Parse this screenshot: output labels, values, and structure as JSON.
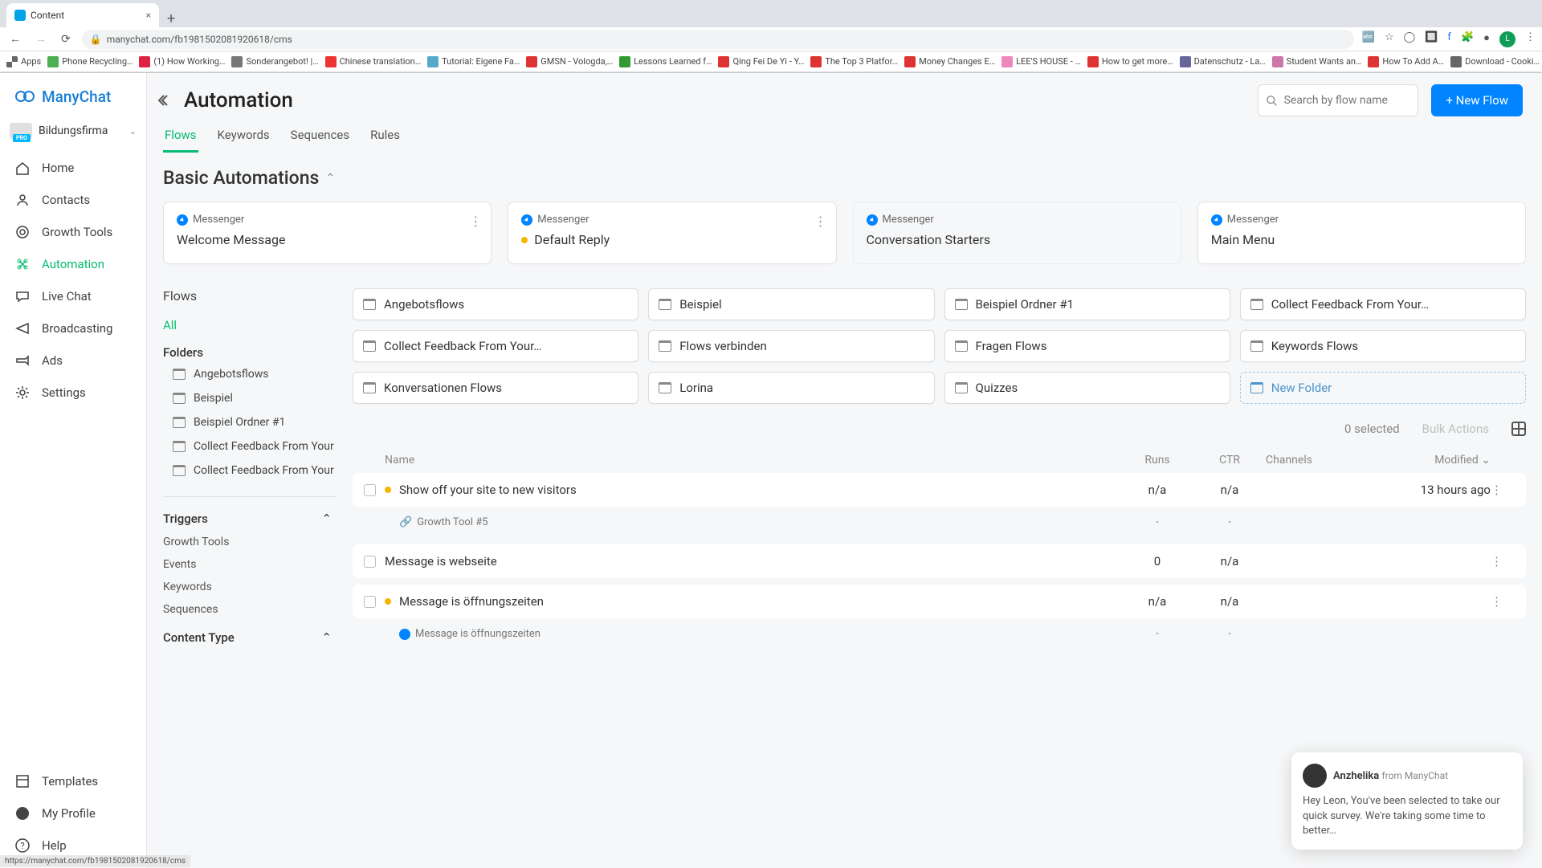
{
  "browser": {
    "tab_title": "Content",
    "url": "manychat.com/fb1981502081920618/cms",
    "bookmarks": [
      {
        "label": "Apps",
        "color": "#666"
      },
      {
        "label": "Phone Recycling…",
        "color": "#4caf50"
      },
      {
        "label": "(1) How Working…",
        "color": "#d24"
      },
      {
        "label": "Sonderangebot! |…",
        "color": "#777"
      },
      {
        "label": "Chinese translation…",
        "color": "#e33"
      },
      {
        "label": "Tutorial: Eigene Fa…",
        "color": "#5ac"
      },
      {
        "label": "GMSN - Vologda,…",
        "color": "#d33"
      },
      {
        "label": "Lessons Learned f…",
        "color": "#393"
      },
      {
        "label": "Qing Fei De Yi - Y…",
        "color": "#d33"
      },
      {
        "label": "The Top 3 Platfor…",
        "color": "#d33"
      },
      {
        "label": "Money Changes E…",
        "color": "#d33"
      },
      {
        "label": "LEE'S HOUSE - …",
        "color": "#e8b"
      },
      {
        "label": "How to get more…",
        "color": "#d33"
      },
      {
        "label": "Datenschutz - La…",
        "color": "#669"
      },
      {
        "label": "Student Wants an…",
        "color": "#c7a"
      },
      {
        "label": "How To Add A…",
        "color": "#d33"
      },
      {
        "label": "Download - Cooki…",
        "color": "#666"
      }
    ]
  },
  "brand": "ManyChat",
  "workspace": {
    "name": "Bildungsfirma",
    "badge": "PRO"
  },
  "sidebar": {
    "items": [
      {
        "label": "Home"
      },
      {
        "label": "Contacts"
      },
      {
        "label": "Growth Tools"
      },
      {
        "label": "Automation"
      },
      {
        "label": "Live Chat"
      },
      {
        "label": "Broadcasting"
      },
      {
        "label": "Ads"
      },
      {
        "label": "Settings"
      }
    ],
    "bottom": [
      {
        "label": "Templates"
      },
      {
        "label": "My Profile"
      },
      {
        "label": "Help"
      }
    ]
  },
  "header": {
    "title": "Automation",
    "search_placeholder": "Search by flow name",
    "new_flow": "+ New Flow"
  },
  "tabs": [
    "Flows",
    "Keywords",
    "Sequences",
    "Rules"
  ],
  "basic": {
    "title": "Basic Automations",
    "cards": [
      {
        "channel": "Messenger",
        "title": "Welcome Message",
        "dot": false,
        "dashed": false,
        "menu": true
      },
      {
        "channel": "Messenger",
        "title": "Default Reply",
        "dot": true,
        "dashed": false,
        "menu": true
      },
      {
        "channel": "Messenger",
        "title": "Conversation Starters",
        "dot": false,
        "dashed": true,
        "menu": false
      },
      {
        "channel": "Messenger",
        "title": "Main Menu",
        "dot": false,
        "dashed": false,
        "menu": false
      }
    ]
  },
  "leftpanel": {
    "flows_label": "Flows",
    "all": "All",
    "folders_label": "Folders",
    "folders": [
      "Angebotsflows",
      "Beispiel",
      "Beispiel Ordner #1",
      "Collect Feedback From Your Cu",
      "Collect Feedback From Your Cu"
    ],
    "triggers_label": "Triggers",
    "triggers": [
      "Growth Tools",
      "Events",
      "Keywords",
      "Sequences"
    ],
    "content_type_label": "Content Type"
  },
  "folder_cards": [
    "Angebotsflows",
    "Beispiel",
    "Beispiel Ordner #1",
    "Collect Feedback From Your…",
    "Collect Feedback From Your…",
    "Flows verbinden",
    "Fragen Flows",
    "Keywords Flows",
    "Konversationen Flows",
    "Lorina",
    "Quizzes"
  ],
  "new_folder_label": "New Folder",
  "list_actions": {
    "selected": "0 selected",
    "bulk": "Bulk Actions"
  },
  "table": {
    "cols": {
      "name": "Name",
      "runs": "Runs",
      "ctr": "CTR",
      "channels": "Channels",
      "modified": "Modified"
    },
    "rows": [
      {
        "name": "Show off your site to new visitors",
        "runs": "n/a",
        "ctr": "n/a",
        "channels": "",
        "modified": "13 hours ago",
        "dot": true,
        "sub": {
          "label": "Growth Tool #5",
          "runs": "-",
          "ctr": "-"
        }
      },
      {
        "name": "Message is webseite",
        "runs": "0",
        "ctr": "n/a",
        "channels": "blue",
        "modified": "",
        "dot": false
      },
      {
        "name": "Message is öffnungszeiten",
        "runs": "n/a",
        "ctr": "n/a",
        "channels": "",
        "modified": "",
        "dot": true,
        "sub": {
          "label": "Message is öffnungszeiten",
          "runs": "-",
          "ctr": "-",
          "blue": true
        }
      }
    ]
  },
  "chat": {
    "name": "Anzhelika",
    "from": "from ManyChat",
    "text": "Hey Leon,  You've been selected to take our quick survey. We're taking some time to better…"
  },
  "status": "https://manychat.com/fb1981502081920618/cms"
}
